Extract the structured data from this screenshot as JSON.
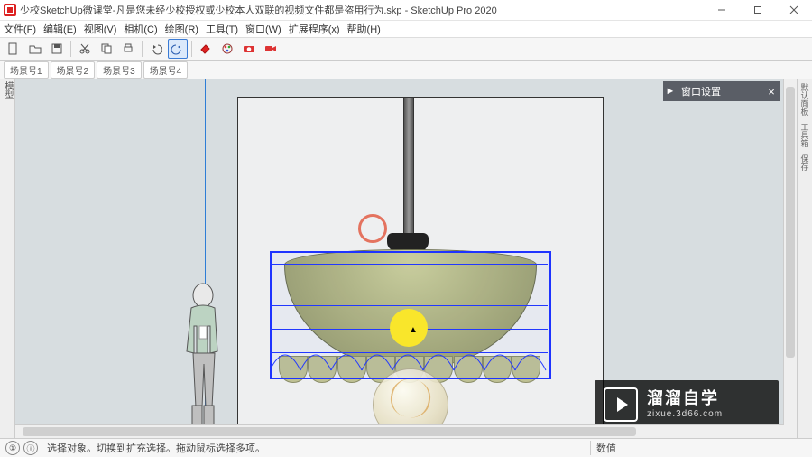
{
  "window": {
    "title": "少校SketchUp微课堂-凡是您未经少校授权或少校本人双联的视频文件都是盗用行为.skp - SketchUp Pro 2020",
    "min_tip": "最小化",
    "max_tip": "还原",
    "close_tip": "关闭"
  },
  "menu": {
    "items": [
      "文件(F)",
      "编辑(E)",
      "视图(V)",
      "相机(C)",
      "绘图(R)",
      "工具(T)",
      "窗口(W)",
      "扩展程序(x)",
      "帮助(H)"
    ]
  },
  "scenes": {
    "items": [
      "场景号1",
      "场景号2",
      "场景号3",
      "场景号4"
    ]
  },
  "left_label": "模型",
  "right_labels": [
    "默认面板",
    "工具箱",
    "保存"
  ],
  "panel": {
    "title": "窗口设置",
    "arrow": "►",
    "close": "×"
  },
  "status": {
    "hint": "选择对象。切换到扩充选择。拖动鼠标选择多项。",
    "measure_label": "数值",
    "icon1": "①",
    "icon2": "ⓘ"
  },
  "watermark": {
    "big": "溜溜自学",
    "small": "zixue.3d66.com"
  },
  "cursor_glyph": "▲",
  "colors": {
    "axis": "#2e7dd6",
    "selection": "#1e33ff",
    "highlight": "#f9e62b",
    "marker": "#e4735f"
  }
}
